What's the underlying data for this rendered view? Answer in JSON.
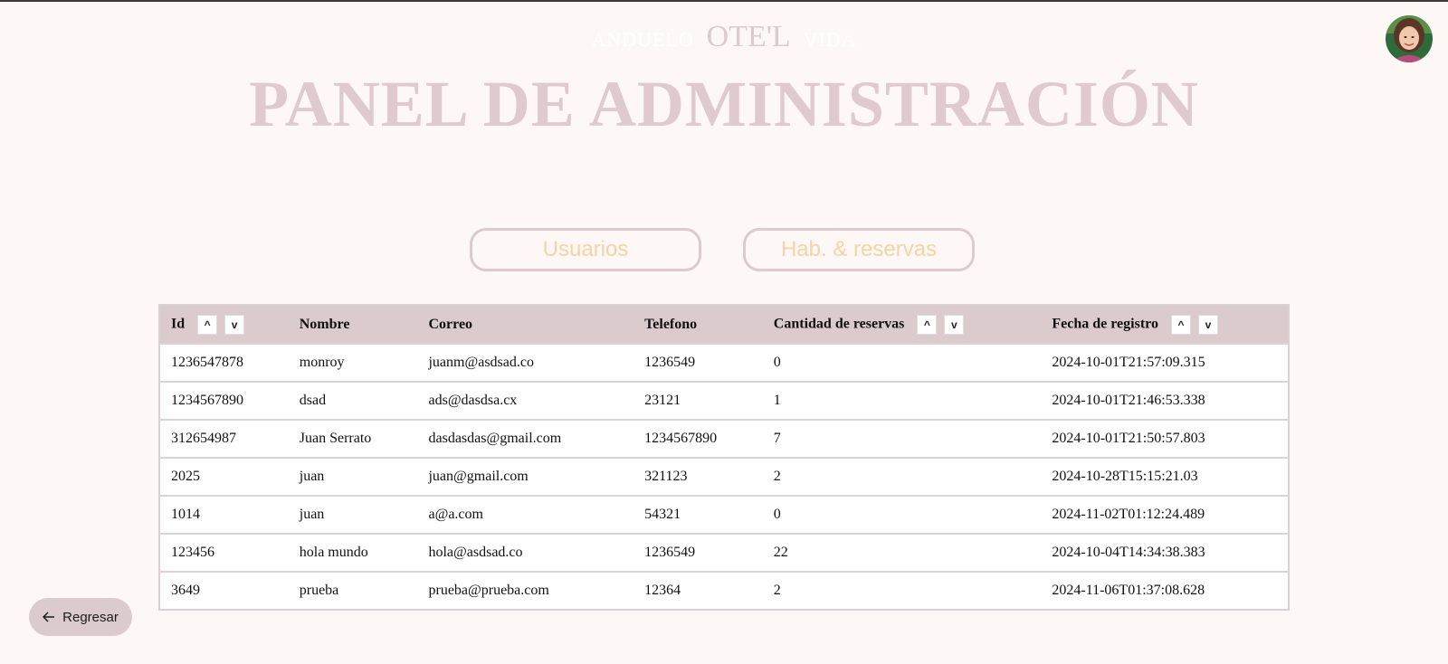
{
  "brand": {
    "left_text": "ANDUELO",
    "main_text": "OTE'L",
    "right_text": "VIDA"
  },
  "page_title": "PANEL DE ADMINISTRACIÓN",
  "tabs": [
    {
      "label": "Usuarios"
    },
    {
      "label": "Hab. & reservas"
    }
  ],
  "table": {
    "headers": [
      "Id",
      "Nombre",
      "Correo",
      "Telefono",
      "Cantidad de reservas",
      "Fecha de registro"
    ],
    "sort_up_label": "^",
    "sort_down_label": "v",
    "rows": [
      [
        "1236547878",
        "monroy",
        "juanm@asdsad.co",
        "1236549",
        "0",
        "2024-10-01T21:57:09.315"
      ],
      [
        "1234567890",
        "dsad",
        "ads@dasdsa.cx",
        "23121",
        "1",
        "2024-10-01T21:46:53.338"
      ],
      [
        "312654987",
        "Juan Serrato",
        "dasdasdas@gmail.com",
        "1234567890",
        "7",
        "2024-10-01T21:50:57.803"
      ],
      [
        "2025",
        "juan",
        "juan@gmail.com",
        "321123",
        "2",
        "2024-10-28T15:15:21.03"
      ],
      [
        "1014",
        "juan",
        "a@a.com",
        "54321",
        "0",
        "2024-11-02T01:12:24.489"
      ],
      [
        "123456",
        "hola mundo",
        "hola@asdsad.co",
        "1236549",
        "22",
        "2024-10-04T14:34:38.383"
      ],
      [
        "3649",
        "prueba",
        "prueba@prueba.com",
        "12364",
        "2",
        "2024-11-06T01:37:08.628"
      ]
    ]
  },
  "back_button": {
    "label": "Regresar",
    "icon": "arrow-left-icon"
  },
  "avatar": {
    "icon": "user-avatar"
  },
  "colors": {
    "background": "#fdf8f6",
    "accent": "#dccbcd",
    "tab_text": "#f3d4a6"
  }
}
